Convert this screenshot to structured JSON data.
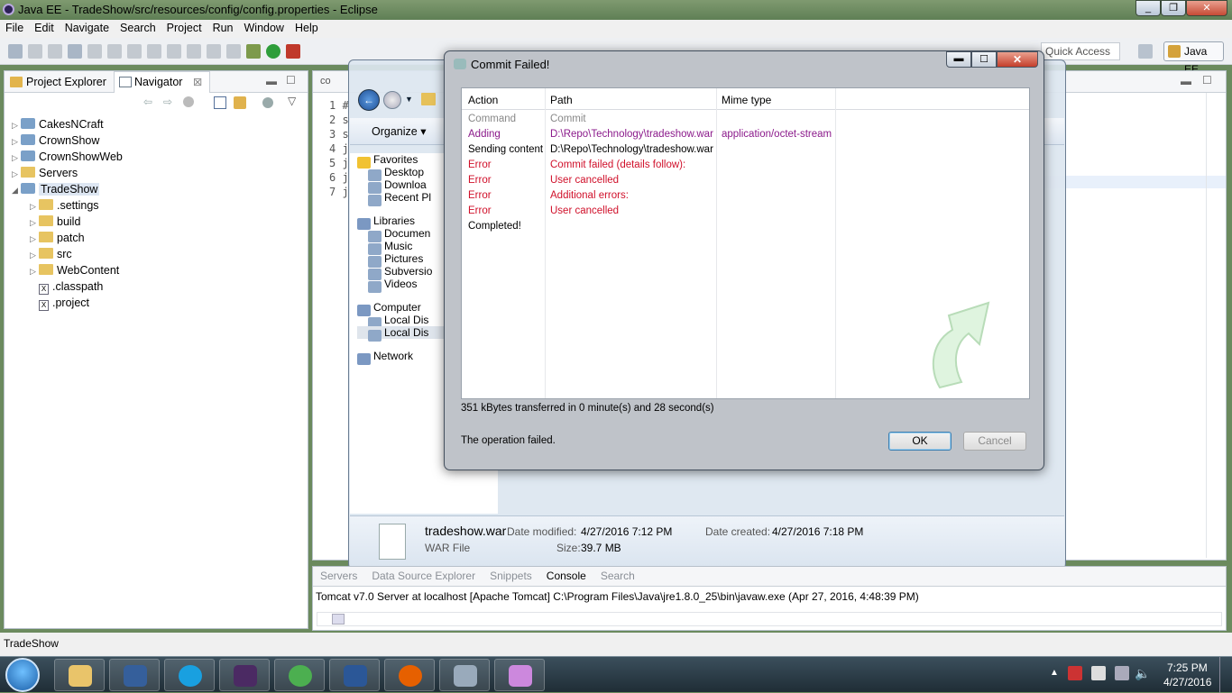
{
  "window": {
    "title": "Java EE - TradeShow/src/resources/config/config.properties - Eclipse"
  },
  "menu": [
    "File",
    "Edit",
    "Navigate",
    "Search",
    "Project",
    "Run",
    "Window",
    "Help"
  ],
  "toolbar": {
    "quick_access": "Quick Access",
    "perspective": "Java EE"
  },
  "left_panel": {
    "tabs": [
      "Project Explorer",
      "Navigator"
    ],
    "tree": [
      {
        "label": "CakesNCraft",
        "level": 0,
        "icon": "project",
        "twisty": "▷"
      },
      {
        "label": "CrownShow",
        "level": 0,
        "icon": "project",
        "twisty": "▷"
      },
      {
        "label": "CrownShowWeb",
        "level": 0,
        "icon": "project",
        "twisty": "▷"
      },
      {
        "label": "Servers",
        "level": 0,
        "icon": "folder",
        "twisty": "▷"
      },
      {
        "label": "TradeShow",
        "level": 0,
        "icon": "project",
        "twisty": "◢"
      },
      {
        "label": ".settings",
        "level": 1,
        "icon": "folder",
        "twisty": "▷"
      },
      {
        "label": "build",
        "level": 1,
        "icon": "folder",
        "twisty": "▷"
      },
      {
        "label": "patch",
        "level": 1,
        "icon": "folder",
        "twisty": "▷"
      },
      {
        "label": "src",
        "level": 1,
        "icon": "folder",
        "twisty": "▷"
      },
      {
        "label": "WebContent",
        "level": 1,
        "icon": "folder",
        "twisty": "▷"
      },
      {
        "label": ".classpath",
        "level": 1,
        "icon": "xml",
        "twisty": ""
      },
      {
        "label": ".project",
        "level": 1,
        "icon": "xml",
        "twisty": ""
      }
    ]
  },
  "editor": {
    "tab": "co",
    "lines": [
      "1 #",
      "2 s",
      "3 s",
      "4 j",
      "5 j",
      "6 j",
      "7 j"
    ]
  },
  "explorer": {
    "organize": "Organize ▾",
    "nav": [
      {
        "label": "Favorites",
        "group": true
      },
      {
        "label": "Desktop"
      },
      {
        "label": "Downloa"
      },
      {
        "label": "Recent Pl"
      },
      {
        "label": "Libraries",
        "group": true
      },
      {
        "label": "Documen"
      },
      {
        "label": "Music"
      },
      {
        "label": "Pictures"
      },
      {
        "label": "Subversio"
      },
      {
        "label": "Videos"
      },
      {
        "label": "Computer",
        "group": true
      },
      {
        "label": "Local Dis"
      },
      {
        "label": "Local Dis"
      },
      {
        "label": "Network",
        "group": true
      }
    ],
    "file": {
      "name": "tradeshow.war",
      "type": "WAR File",
      "modified_label": "Date modified:",
      "modified": "4/27/2016 7:12 PM",
      "size_label": "Size:",
      "size": "39.7 MB",
      "created_label": "Date created:",
      "created": "4/27/2016 7:18 PM"
    }
  },
  "dialog": {
    "title": "Commit Failed!",
    "columns": [
      "Action",
      "Path",
      "Mime type"
    ],
    "rows": [
      {
        "action": "Command",
        "path": "Commit",
        "mime": "",
        "color": "#888888"
      },
      {
        "action": "Adding",
        "path": "D:\\Repo\\Technology\\tradeshow.war",
        "mime": "application/octet-stream",
        "color": "#8b1a8b"
      },
      {
        "action": "Sending content",
        "path": "D:\\Repo\\Technology\\tradeshow.war",
        "mime": "",
        "color": "#000000"
      },
      {
        "action": "Error",
        "path": "Commit failed (details follow):",
        "mime": "",
        "color": "#d0102a"
      },
      {
        "action": "Error",
        "path": "User cancelled",
        "mime": "",
        "color": "#d0102a"
      },
      {
        "action": "Error",
        "path": "Additional errors:",
        "mime": "",
        "color": "#d0102a"
      },
      {
        "action": "Error",
        "path": "User cancelled",
        "mime": "",
        "color": "#d0102a"
      },
      {
        "action": "Completed!",
        "path": "",
        "mime": "",
        "color": "#000000"
      }
    ],
    "transfer": "351 kBytes transferred in 0 minute(s) and 28 second(s)",
    "status": "The operation failed.",
    "ok": "OK",
    "cancel": "Cancel"
  },
  "console": {
    "tabs": [
      "Servers",
      "Data Source Explorer",
      "Snippets",
      "Console",
      "Search"
    ],
    "text": "Tomcat v7.0 Server at localhost [Apache Tomcat] C:\\Program Files\\Java\\jre1.8.0_25\\bin\\javaw.exe (Apr 27, 2016, 4:48:39 PM)"
  },
  "statusbar": {
    "text": "TradeShow"
  },
  "taskbar": {
    "time": "7:25 PM",
    "date": "4/27/2016",
    "apps": [
      {
        "name": "file-explorer-icon",
        "color": "#e9c46a"
      },
      {
        "name": "sql-developer-icon",
        "color": "#355f9b"
      },
      {
        "name": "skype-icon",
        "color": "#19a0e0"
      },
      {
        "name": "eclipse-javaee-icon",
        "color": "#4b2a63"
      },
      {
        "name": "chrome-icon",
        "color": "#4caf50"
      },
      {
        "name": "word-icon",
        "color": "#2b5797"
      },
      {
        "name": "firefox-icon",
        "color": "#e66000"
      },
      {
        "name": "paint-icon",
        "color": "#9ab"
      },
      {
        "name": "tortoisesvn-icon",
        "color": "#c8d"
      }
    ]
  }
}
